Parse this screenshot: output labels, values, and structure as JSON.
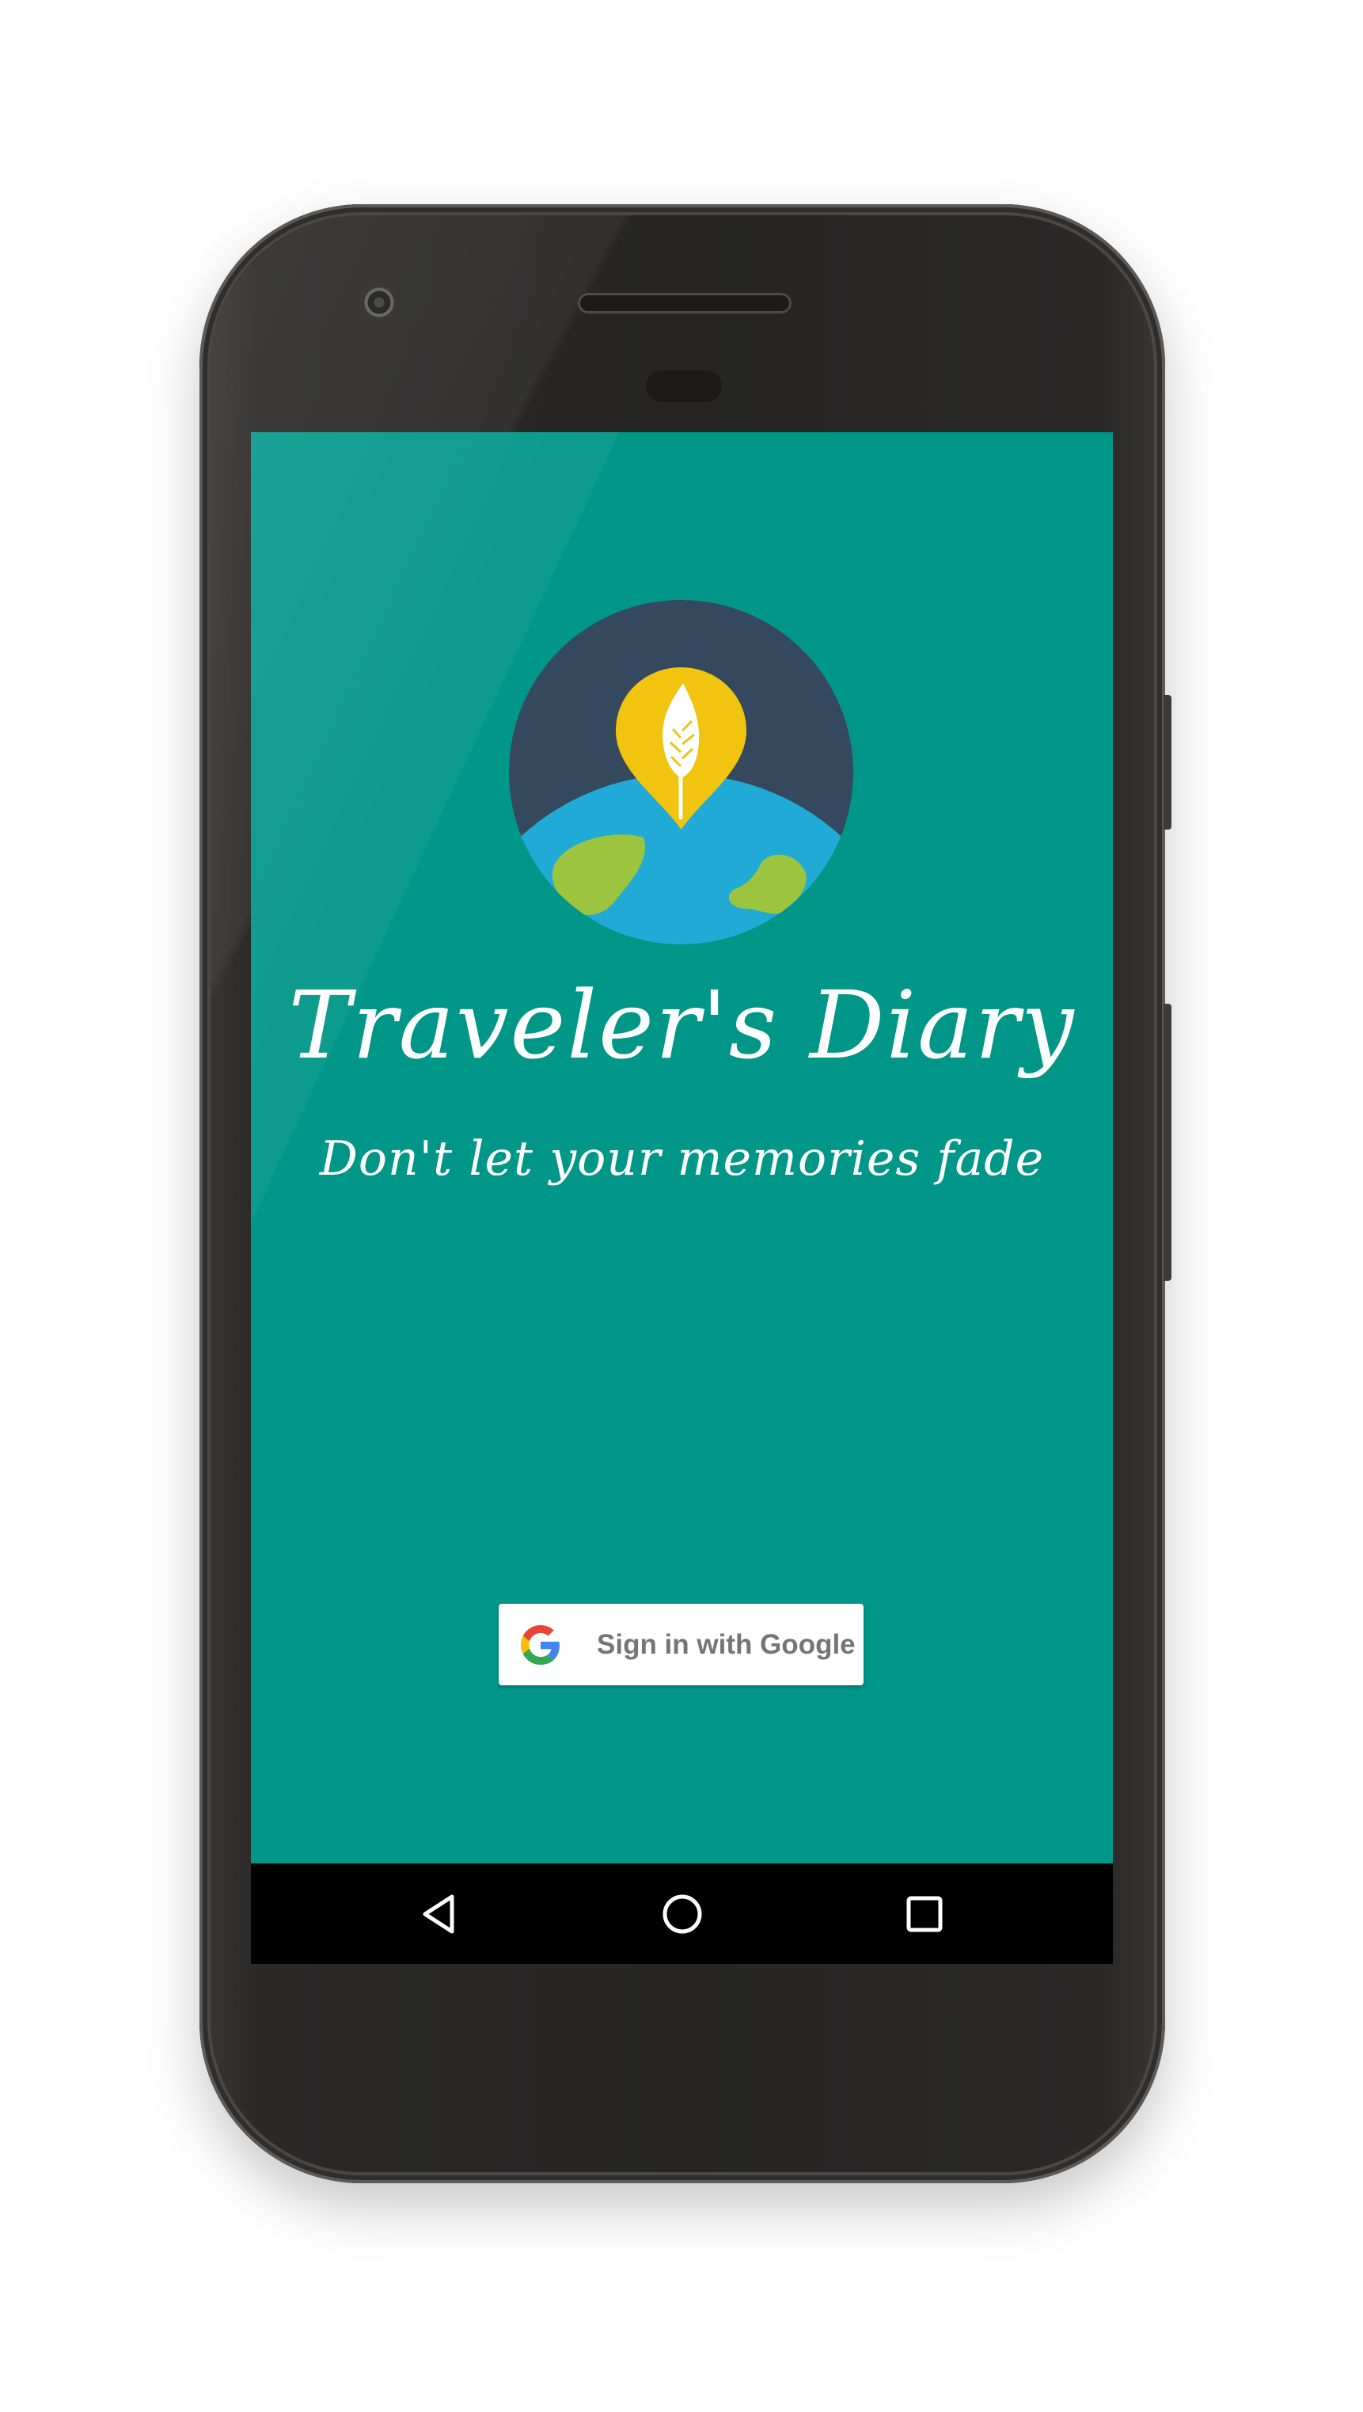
{
  "app": {
    "title": "Traveler's Diary",
    "tagline": "Don't let your memories fade"
  },
  "sign_in": {
    "label": "Sign in with Google",
    "icon": "google-g-icon"
  },
  "logo": {
    "icon": "globe-pin-feather-logo"
  },
  "nav": {
    "back_icon": "back-triangle-icon",
    "home_icon": "home-circle-icon",
    "recents_icon": "recents-square-icon"
  },
  "colors": {
    "screen_background": "#009688",
    "logo_circle": "#34495e",
    "globe_ocean": "#22aad6",
    "globe_land": "#9bc43f",
    "pin": "#f1c40f",
    "button_background": "#ffffff",
    "button_text": "#757575",
    "nav_bar": "#000000"
  }
}
